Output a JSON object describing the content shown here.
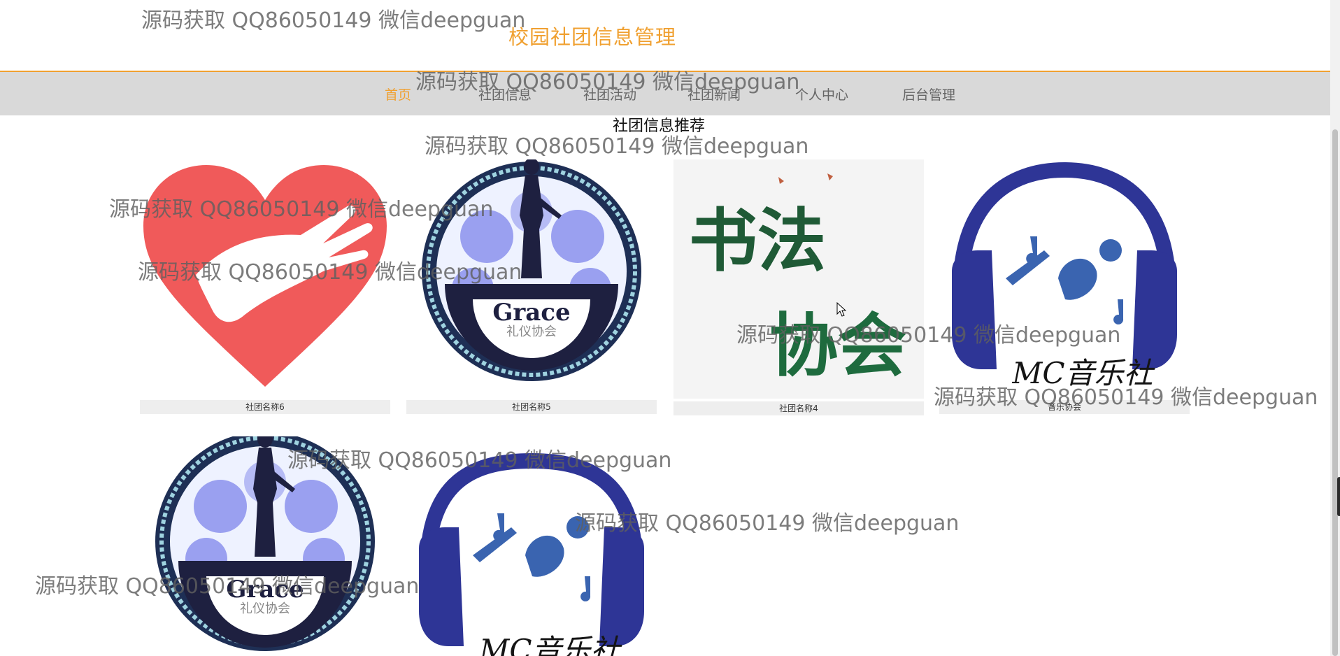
{
  "header": {
    "title": "校园社团信息管理"
  },
  "nav": {
    "items": [
      {
        "label": "首页"
      },
      {
        "label": "社团信息"
      },
      {
        "label": "社团活动"
      },
      {
        "label": "社团新闻"
      },
      {
        "label": "个人中心"
      },
      {
        "label": "后台管理"
      }
    ]
  },
  "section": {
    "title": "社团信息推荐"
  },
  "cards": [
    {
      "name": "社团名称6"
    },
    {
      "name": "社团名称5"
    },
    {
      "name": "社团名称4"
    },
    {
      "name": "音乐协会"
    }
  ],
  "logos": {
    "grace_text": "Grace",
    "etiquette_text": "礼仪协会",
    "calligraphy_text": [
      "书法",
      "协会"
    ],
    "music_text": "MC音乐社"
  },
  "watermark": "源码获取 QQ86050149 微信deepguan",
  "colors": {
    "accent": "#f0a030",
    "nav_bg": "#d9d9d9"
  }
}
